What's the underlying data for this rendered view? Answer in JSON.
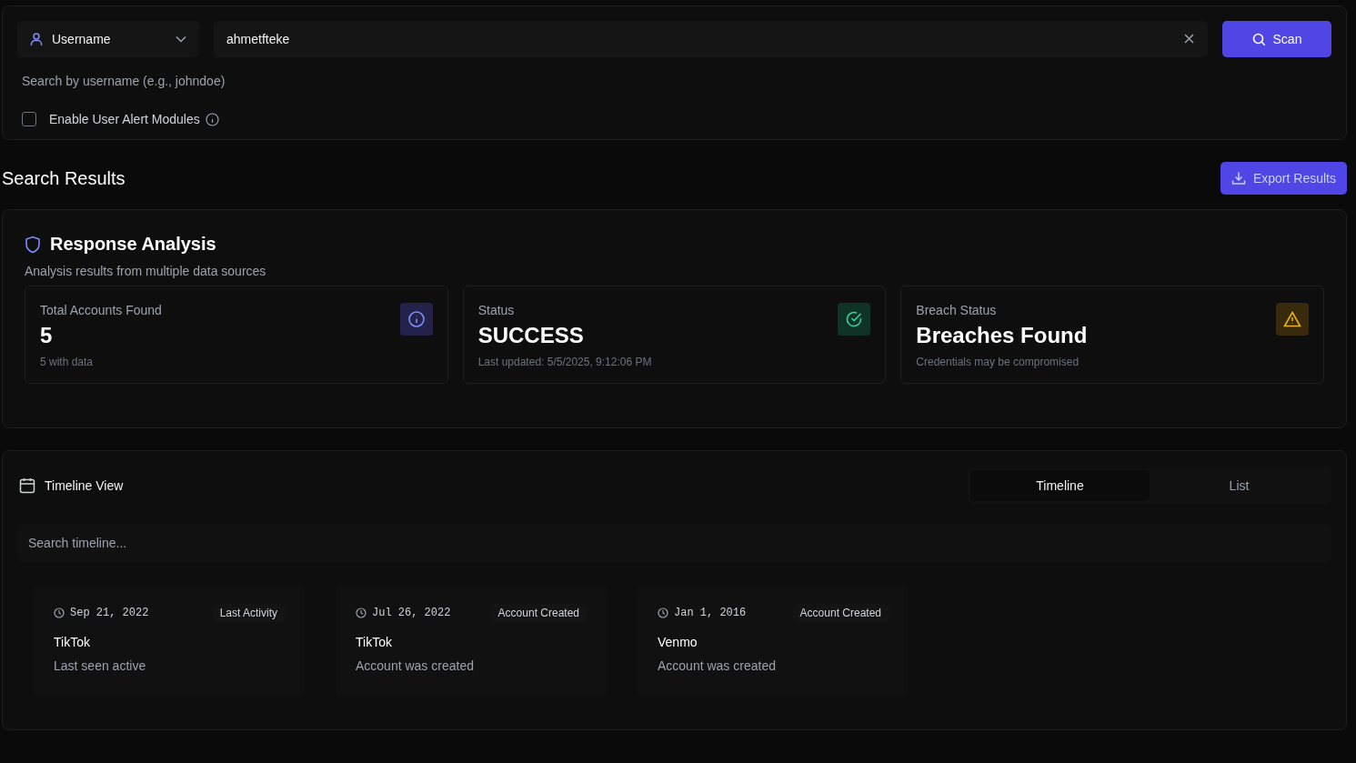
{
  "search": {
    "type_select": "Username",
    "value": "ahmetfteke",
    "scan_button": "Scan",
    "hint": "Search by username (e.g., johndoe)",
    "alert_modules": {
      "label": "Enable User Alert Modules",
      "checked": false
    }
  },
  "results": {
    "title": "Search Results",
    "export_button": "Export Results"
  },
  "analysis": {
    "title": "Response Analysis",
    "subtitle": "Analysis results from multiple data sources",
    "cards": [
      {
        "kind": "info",
        "label": "Total Accounts Found",
        "value": "5",
        "note": "5 with data"
      },
      {
        "kind": "success",
        "label": "Status",
        "value": "SUCCESS",
        "note": "Last updated: 5/5/2025, 9:12:06 PM"
      },
      {
        "kind": "warning",
        "label": "Breach Status",
        "value": "Breaches Found",
        "note": "Credentials may be compromised"
      }
    ]
  },
  "timeline": {
    "title": "Timeline View",
    "tabs": [
      {
        "label": "Timeline",
        "selected": true
      },
      {
        "label": "List",
        "selected": false
      }
    ],
    "search_placeholder": "Search timeline...",
    "events": [
      {
        "date": "Sep 21, 2022",
        "tag": "Last Activity",
        "platform": "TikTok",
        "description": "Last seen active"
      },
      {
        "date": "Jul 26, 2022",
        "tag": "Account Created",
        "platform": "TikTok",
        "description": "Account was created"
      },
      {
        "date": "Jan 1, 2016",
        "tag": "Account Created",
        "platform": "Venmo",
        "description": "Account was created"
      }
    ]
  }
}
